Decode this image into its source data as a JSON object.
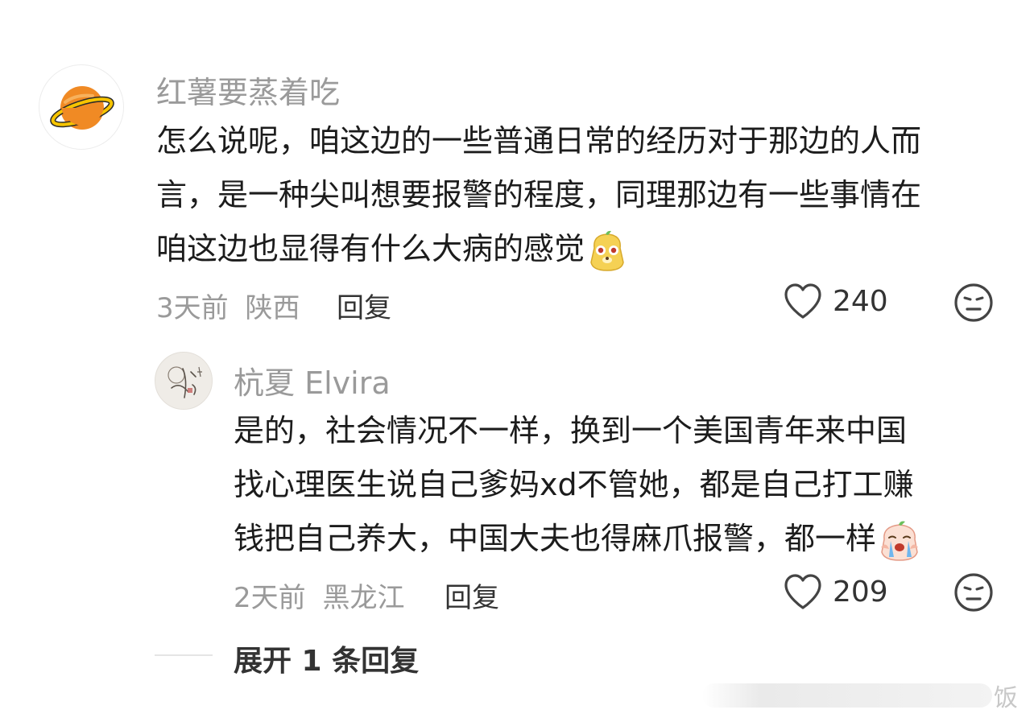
{
  "comment": {
    "username": "红薯要蒸着吃",
    "avatar_icon": "planet-icon",
    "lines": [
      "怎么说呢，咱这边的一些普通日常的经历对于那边的人而",
      "言，是一种尖叫想要报警的程度，同理那边有一些事情在",
      "咱这边也显得有什么大病的感觉"
    ],
    "time": "3天前",
    "location": "陕西",
    "reply_label": "回复",
    "likes": "240"
  },
  "reply": {
    "username": "杭夏 Elvira",
    "avatar_icon": "calligraphy-avatar",
    "lines": [
      "是的，社会情况不一样，换到一个美国青年来中国",
      "找心理医生说自己爹妈xd不管她，都是自己打工赚",
      "钱把自己养大，中国大夫也得麻爪报警，都一样"
    ],
    "time": "2天前",
    "location": "黑龙江",
    "reply_label": "回复",
    "likes": "209"
  },
  "expand_label": "展开 1 条回复",
  "watermark_text": "饭",
  "colors": {
    "muted_text": "#9a9a9a",
    "body_text": "#1c1c1c",
    "planet_orange": "#f08a24",
    "planet_ring": "#f6c400"
  }
}
